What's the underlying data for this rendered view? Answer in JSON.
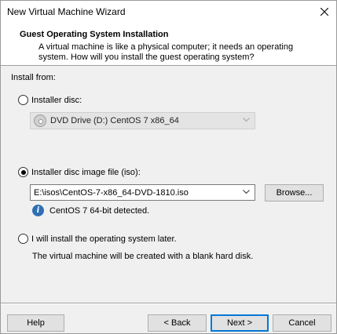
{
  "window": {
    "title": "New Virtual Machine Wizard",
    "close_glyph": "✕"
  },
  "header": {
    "title": "Guest Operating System Installation",
    "description": "A virtual machine is like a physical computer; it needs an operating system. How will you install the guest operating system?"
  },
  "install_from": {
    "label": "Install from:",
    "options": {
      "installer_disc": {
        "label": "Installer disc:",
        "selected": false,
        "drive_value": "DVD Drive (D:) CentOS 7 x86_64"
      },
      "iso": {
        "label": "Installer disc image file (iso):",
        "selected": true,
        "path_value": "E:\\isos\\CentOS-7-x86_64-DVD-1810.iso",
        "browse_label": "Browse...",
        "detected_text": "CentOS 7 64-bit detected."
      },
      "later": {
        "label": "I will install the operating system later.",
        "selected": false,
        "description": "The virtual machine will be created with a blank hard disk."
      }
    }
  },
  "footer": {
    "help_label": "Help",
    "back_label": "< Back",
    "next_label": "Next >",
    "cancel_label": "Cancel"
  },
  "icons": {
    "close": "close-icon",
    "dvd": "dvd-drive-icon",
    "info": "info-icon",
    "chevron": "chevron-down-icon"
  }
}
